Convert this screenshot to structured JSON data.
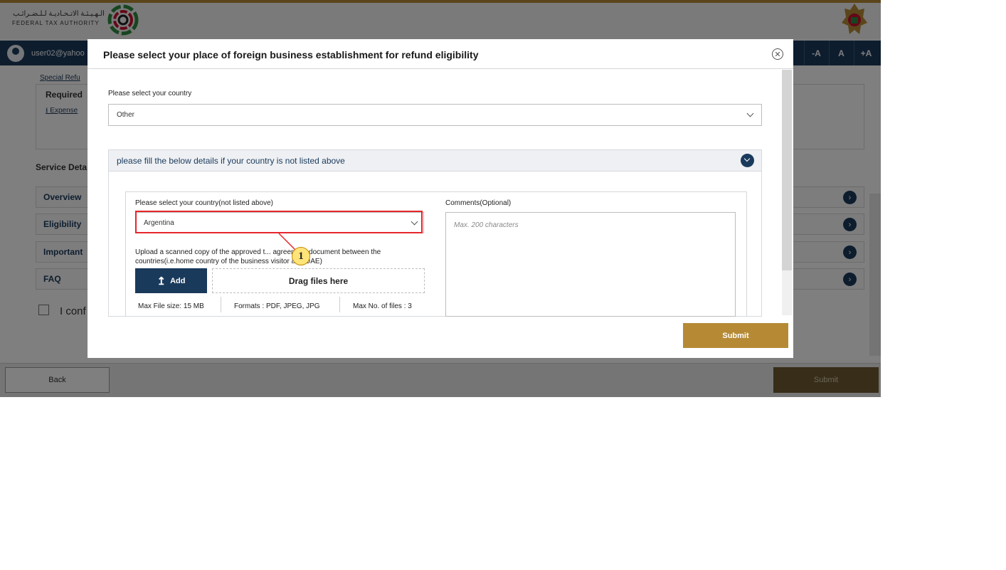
{
  "header": {
    "logo_arabic": "الـهـيـئـة الاتـحـاديـة لـلـضـرائـب",
    "logo_english": "FEDERAL TAX AUTHORITY"
  },
  "nav": {
    "user": "user02@yahoo",
    "font_controls": [
      "-A",
      "A",
      "+A"
    ]
  },
  "page": {
    "breadcrumb": "Special Refu",
    "required_title": "Required",
    "required_link": "Expense",
    "service_title": "Service Deta",
    "accordions": [
      "Overview",
      "Eligibility",
      "Important",
      "FAQ"
    ],
    "confirm_text": "I conf",
    "back_label": "Back",
    "submit_label": "Submit"
  },
  "modal": {
    "title": "Please select your place of foreign business establishment for refund eligibility",
    "country_label": "Please select your country",
    "country_value": "Other",
    "section_title": "please fill the below details if your country is not listed above",
    "other_country_label": "Please select your country(not listed above)",
    "other_country_value": "Argentina",
    "upload_text": "Upload a scanned copy of the approved t... agreement document between the countries(i.e.home country of the business visitor and UAE)",
    "add_label": "Add",
    "drop_label": "Drag files here",
    "max_size": "Max File size: 15 MB",
    "formats": "Formats : PDF, JPEG, JPG",
    "max_files": "Max No. of files : 3",
    "comments_label": "Comments(Optional)",
    "comments_placeholder": "Max. 200 characters",
    "submit_label": "Submit"
  },
  "annotation": {
    "callout_number": "1",
    "highlight_color": "#e5262b",
    "callout_color": "#ffe47a"
  },
  "colors": {
    "navy": "#1a3a5c",
    "gold": "#b68a35"
  }
}
